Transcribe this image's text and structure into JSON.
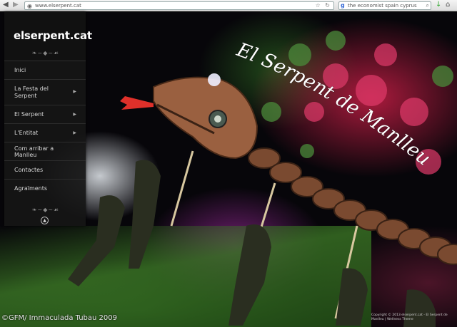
{
  "browser": {
    "url": "www.elserpent.cat",
    "search_value": "the economist spain cyprus"
  },
  "sidebar": {
    "brand": "elserpent.cat",
    "items": [
      {
        "label": "Inici",
        "has_submenu": false
      },
      {
        "label": "La Festa del Serpent",
        "has_submenu": true
      },
      {
        "label": "El Serpent",
        "has_submenu": true
      },
      {
        "label": "L'Entitat",
        "has_submenu": true
      },
      {
        "label": "Com arribar a Manlleu",
        "has_submenu": false
      },
      {
        "label": "Contactes",
        "has_submenu": false
      },
      {
        "label": "Agraïments",
        "has_submenu": false
      }
    ]
  },
  "hero": {
    "headline": "El Serpent de Manlleu",
    "photo_credit": "©GFM/ Immaculada Tubau 2009",
    "copyright": "Copyright © 2013 elserpent.cat - El Serpent de Manlleu | Wellness Theme"
  },
  "colors": {
    "sidebar_bg": "#161616",
    "headline": "#ffffff"
  }
}
